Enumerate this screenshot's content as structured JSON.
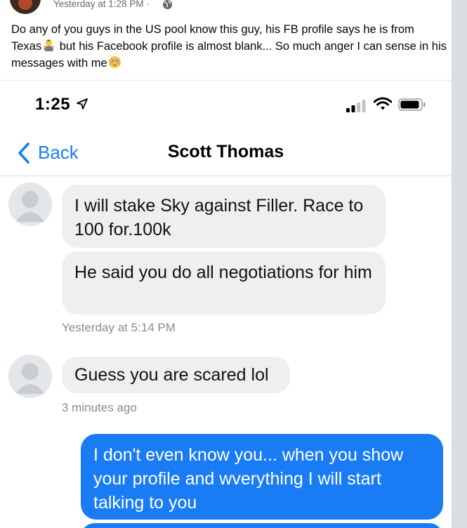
{
  "post": {
    "timestamp": "Yesterday at 1:28 PM",
    "separator": "·",
    "privacy_icon": "globe-icon",
    "text_1": "Do any of you guys in the US pool know this guy, his FB profile says he is from Texas",
    "text_2": " but his Facebook profile is almost blank... So much anger I can sense in his messages with me",
    "emoji_1": "man-shrugging-emoji",
    "emoji_2": "flushed-face-emoji"
  },
  "phone": {
    "status_time": "1:25",
    "status_icons": [
      "location-arrow-icon",
      "cellular-signal-icon",
      "wifi-icon",
      "battery-icon"
    ],
    "back_label": "Back",
    "chat_title": "Scott Thomas"
  },
  "messages": [
    {
      "from": "contact",
      "text": "I will stake Sky against Filler.  Race to 100 for.100k"
    },
    {
      "from": "contact",
      "text": "He said you do all negotiations for him"
    },
    {
      "timestamp": "Yesterday at 5:14 PM"
    },
    {
      "from": "contact",
      "text": "Guess you are scared lol"
    },
    {
      "timestamp": "3 minutes ago"
    },
    {
      "from": "me",
      "text": "I don't even know you... when you show your profile and wverything I will start talking to you"
    }
  ],
  "colors": {
    "page_background": "#dadde1",
    "ios_blue": "#1a7cf5",
    "incoming_bubble": "#efefef",
    "timestamp_grey": "#8a8a8e"
  }
}
